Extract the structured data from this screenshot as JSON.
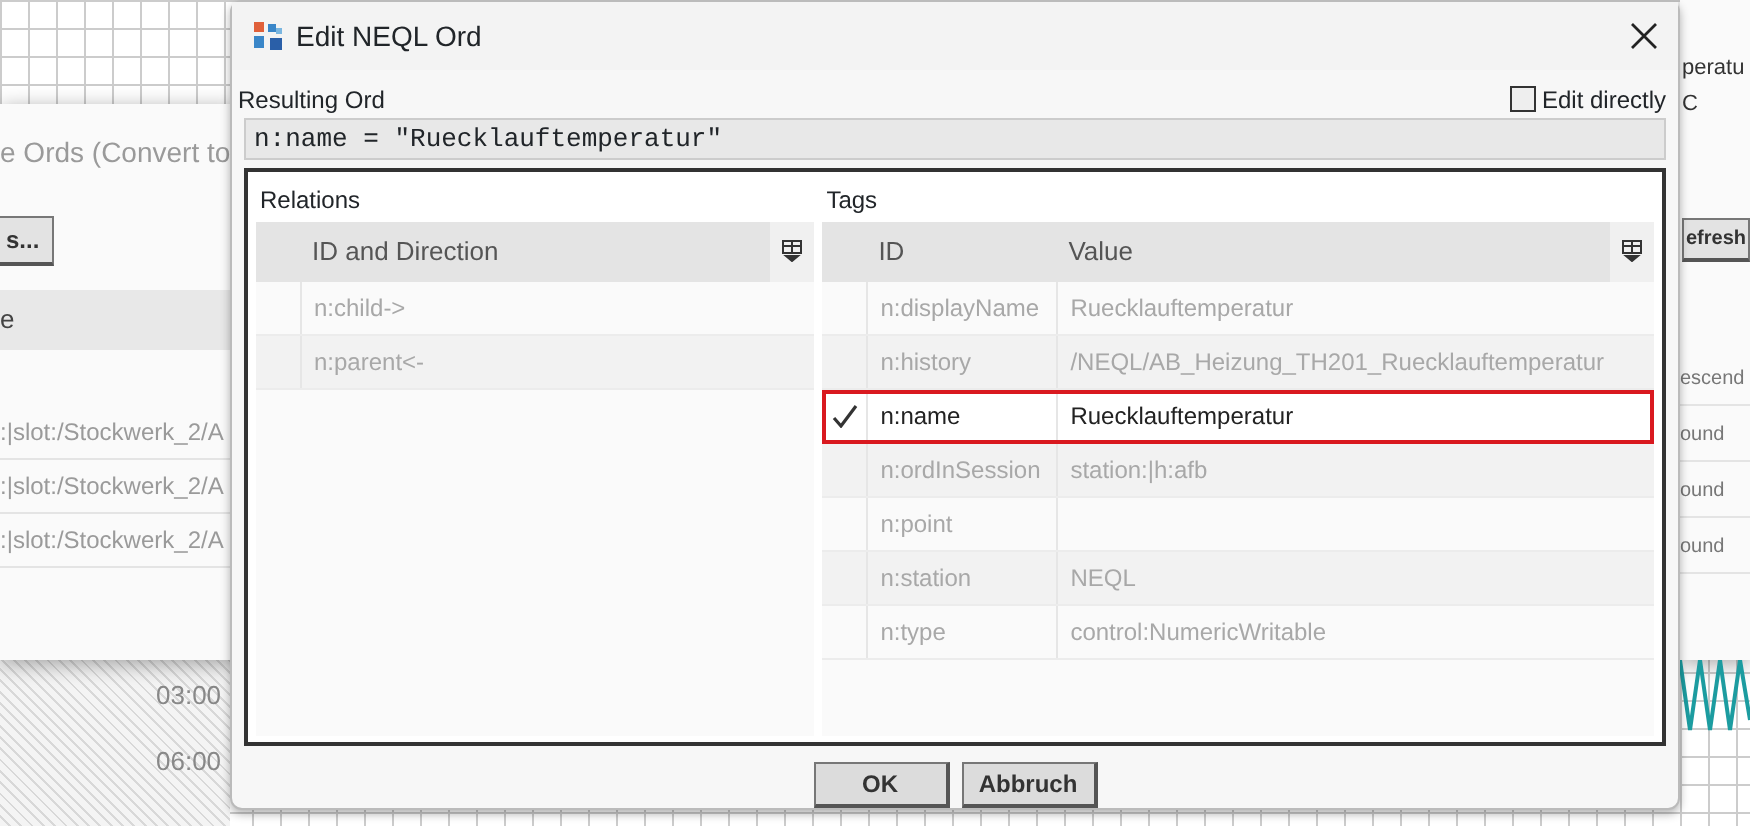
{
  "background": {
    "time_labels": [
      "03:00",
      "06:00"
    ],
    "left_window": {
      "title": "e Ords (Convert to",
      "button": "s...",
      "column_1": "e",
      "rows": [
        ":|slot:/Stockwerk_2/A",
        ":|slot:/Stockwerk_2/A",
        ":|slot:/Stockwerk_2/A"
      ]
    },
    "right_window": {
      "texts": [
        "peratu",
        "C"
      ],
      "button": "efresh",
      "rows": [
        "escend",
        "ound",
        "ound",
        "ound"
      ]
    }
  },
  "dialog": {
    "title": "Edit NEQL Ord",
    "resulting_ord": {
      "label": "Resulting Ord",
      "value": "n:name = \"Ruecklauftemperatur\""
    },
    "edit_directly": {
      "label": "Edit directly",
      "checked": false
    },
    "relations": {
      "title": "Relations",
      "columns": [
        "ID and Direction"
      ],
      "rows": [
        {
          "id": "n:child->"
        },
        {
          "id": "n:parent<-"
        }
      ]
    },
    "tags": {
      "title": "Tags",
      "columns": [
        "ID",
        "Value"
      ],
      "rows": [
        {
          "id": "n:displayName",
          "value": "Ruecklauftemperatur",
          "selected": false
        },
        {
          "id": "n:history",
          "value": "/NEQL/AB_Heizung_TH201_Ruecklauftemperatur",
          "selected": false
        },
        {
          "id": "n:name",
          "value": "Ruecklauftemperatur",
          "selected": true
        },
        {
          "id": "n:ordInSession",
          "value": "station:|h:afb",
          "selected": false
        },
        {
          "id": "n:point",
          "selected": false
        },
        {
          "id": "n:station",
          "value": "NEQL",
          "selected": false
        },
        {
          "id": "n:type",
          "value": "control:NumericWritable",
          "selected": false
        }
      ]
    },
    "buttons": [
      "OK",
      "Abbruch"
    ]
  }
}
